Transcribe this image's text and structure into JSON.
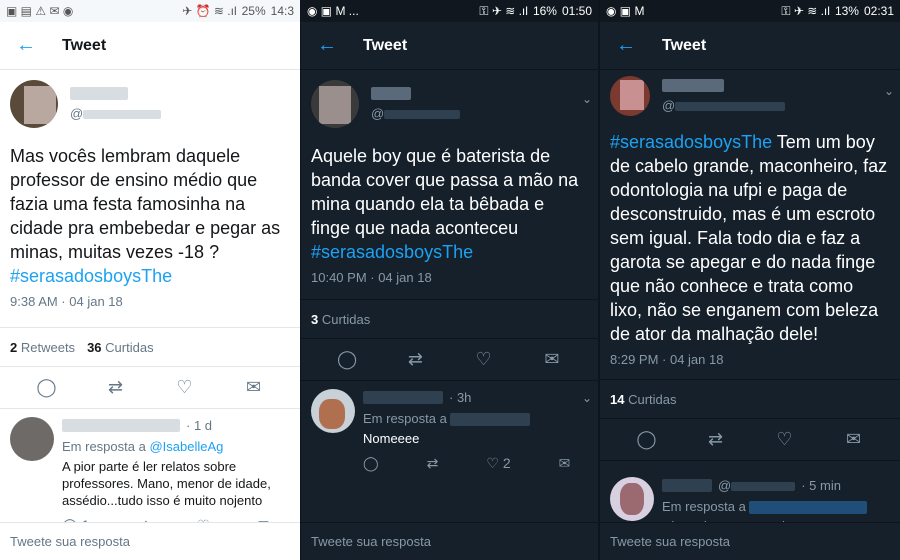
{
  "panel1": {
    "status": {
      "left_icons": "▣ ▤ ⚠ ✉ ◉",
      "battery": "25%",
      "time": "14:3"
    },
    "header": {
      "title": "Tweet"
    },
    "tweet": {
      "handle": "@",
      "text": "Mas vocês lembram daquele professor de ensino médio que fazia uma festa famosinha na cidade pra embebedar e pegar as minas, muitas vezes -18 ?",
      "hashtag": "#serasadosboysThe",
      "meta": "9:38 AM · 04 jan 18",
      "retweets_count": "2",
      "retweets_label": "Retweets",
      "likes_count": "36",
      "likes_label": "Curtidas"
    },
    "reply": {
      "time": "· 1 d",
      "in_reply_label": "Em resposta a",
      "mention": "@IsabelleAg",
      "text": "A pior parte é ler relatos sobre professores. Mano, menor de idade, assédio...tudo isso é muito nojento",
      "reply_count": "1"
    },
    "compose_placeholder": "Tweete sua resposta"
  },
  "panel2": {
    "status": {
      "left_icons": "◉ ▣ M ...",
      "battery": "16%",
      "time": "01:50"
    },
    "header": {
      "title": "Tweet"
    },
    "tweet": {
      "handle": "@",
      "text": "Aquele boy que é baterista de banda cover que passa a mão na mina quando ela ta bêbada e finge que nada aconteceu",
      "hashtag": "#serasadosboysThe",
      "meta": "10:40 PM · 04 jan 18",
      "likes_count": "3",
      "likes_label": "Curtidas"
    },
    "reply": {
      "time": "· 3h",
      "in_reply_label": "Em resposta a",
      "text": "Nomeeee",
      "like_count": "2"
    },
    "compose_placeholder": "Tweete sua resposta"
  },
  "panel3": {
    "status": {
      "left_icons": "◉ ▣ M",
      "battery": "13%",
      "time": "02:31"
    },
    "header": {
      "title": "Tweet"
    },
    "tweet": {
      "handle": "@",
      "hashtag": "#serasadosboysThe",
      "text": " Tem um boy de cabelo grande, maconheiro, faz odontologia na ufpi e paga de desconstruido, mas é um escroto sem igual. Fala todo dia e faz a garota se apegar e do nada finge que não conhece e trata como lixo, não se enganem com beleza de ator da malhação dele!",
      "meta": "8:29 PM · 04 jan 18",
      "likes_count": "14",
      "likes_label": "Curtidas"
    },
    "reply": {
      "time": "· 5 min",
      "handle": "@",
      "in_reply_label": "Em resposta a",
      "text": "Chocado que eu conheço KKKKKKK"
    },
    "compose_placeholder": "Tweete sua resposta"
  },
  "colors": {
    "accent": "#1da1f2",
    "dark_bg": "#15202b",
    "light_bg": "#ffffff"
  },
  "icons": {
    "back": "arrow-left-icon",
    "reply": "reply-icon",
    "retweet": "retweet-icon",
    "like": "heart-icon",
    "dm": "mail-icon"
  }
}
